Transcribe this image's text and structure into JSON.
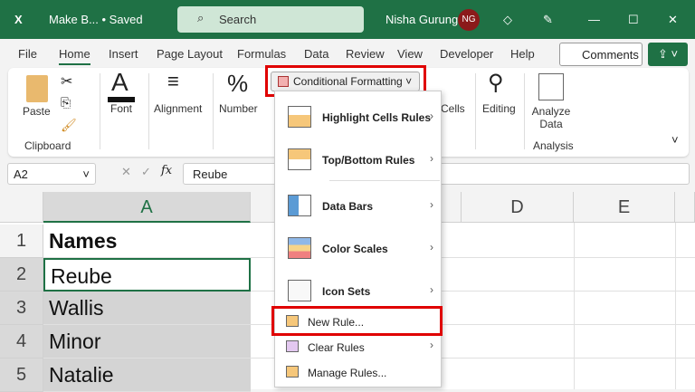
{
  "titlebar": {
    "doc": "Make B... • Saved",
    "search": "Search",
    "user": "Nisha Gurung",
    "initials": "NG"
  },
  "tabs": [
    "File",
    "Home",
    "Insert",
    "Page Layout",
    "Formulas",
    "Data",
    "Review",
    "View",
    "Developer",
    "Help"
  ],
  "comments": "Comments",
  "ribbon": {
    "paste": "Paste",
    "clipboard": "Clipboard",
    "font": "Font",
    "alignment": "Alignment",
    "number": "Number",
    "cf": "Conditional Formatting",
    "cells": "Cells",
    "editing": "Editing",
    "analyze": "Analyze Data",
    "analysis": "Analysis"
  },
  "formula": {
    "namebox": "A2",
    "fx": "fx",
    "value": "Reube"
  },
  "columns": [
    "A",
    "D",
    "E"
  ],
  "rows": [
    "1",
    "2",
    "3",
    "4",
    "5"
  ],
  "cells": [
    "Names",
    "Reube",
    "Wallis",
    "Minor",
    "Natalie"
  ],
  "menu": {
    "items": [
      "Highlight Cells Rules",
      "Top/Bottom Rules",
      "Data Bars",
      "Color Scales",
      "Icon Sets"
    ],
    "new_rule": "New Rule...",
    "clear_rules": "Clear Rules",
    "manage_rules": "Manage Rules..."
  },
  "colors": {
    "green": "#1f7145",
    "highlight": "#e00000",
    "selection": "#d4d4d4"
  }
}
